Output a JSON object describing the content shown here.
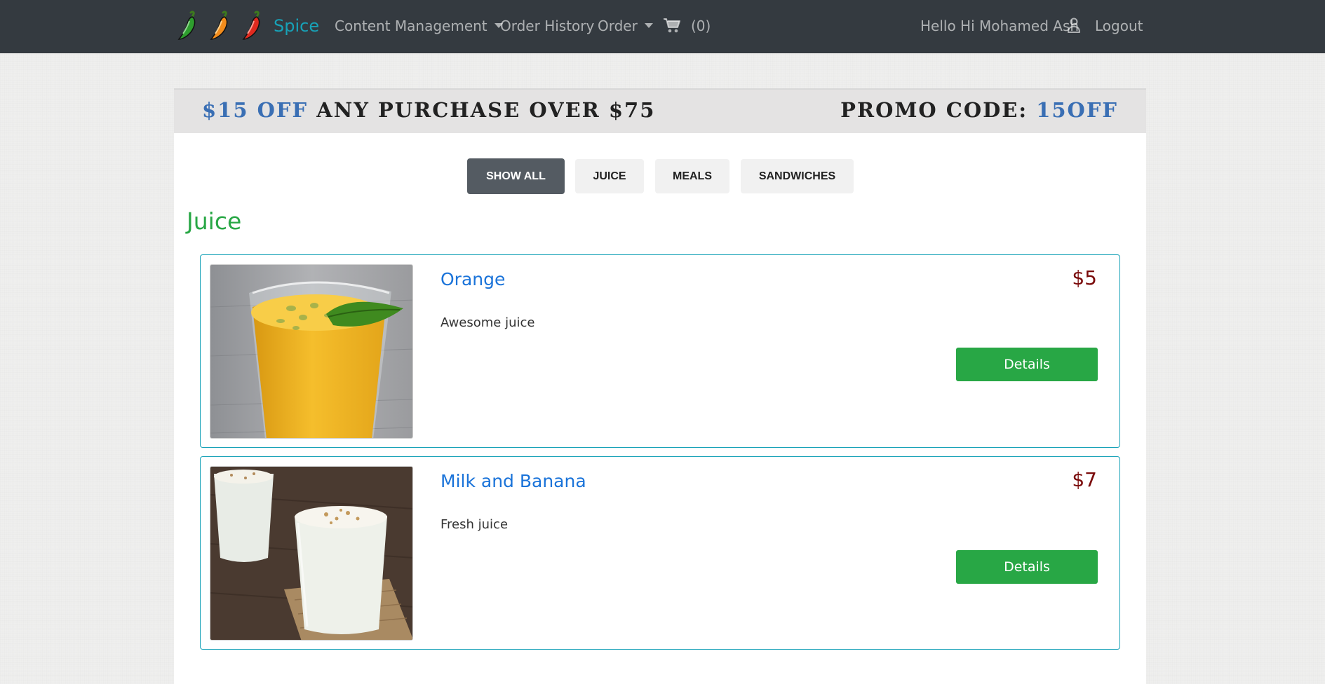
{
  "navbar": {
    "brand": "Spice",
    "content_management": "Content Management",
    "order_history": "Order History",
    "order": "Order",
    "cart_count": "(0)",
    "greeting": "Hello Hi Mohamed Ash",
    "logout": "Logout"
  },
  "promo": {
    "offer_highlight": "$15 off",
    "offer_text": "any purchase over $75",
    "code_label": "Promo code:",
    "code_value": "15off"
  },
  "filters": [
    "Show All",
    "Juice",
    "Meals",
    "Sandwiches"
  ],
  "category": "Juice",
  "items": [
    {
      "name": "Orange",
      "price": "$5",
      "description": "Awesome juice",
      "button": "Details"
    },
    {
      "name": "Milk and Banana",
      "price": "$7",
      "description": "Fresh juice",
      "button": "Details"
    }
  ],
  "colors": {
    "navbar": "#343a40",
    "brand": "#17a2b8",
    "category": "#28a745",
    "item_name": "#1a73d9",
    "price": "#7a0a0a",
    "details_button": "#28a745",
    "active_filter": "#545b62"
  },
  "icons": [
    "pepper-green-icon",
    "pepper-orange-icon",
    "pepper-red-icon",
    "cart-icon",
    "user-icon"
  ]
}
